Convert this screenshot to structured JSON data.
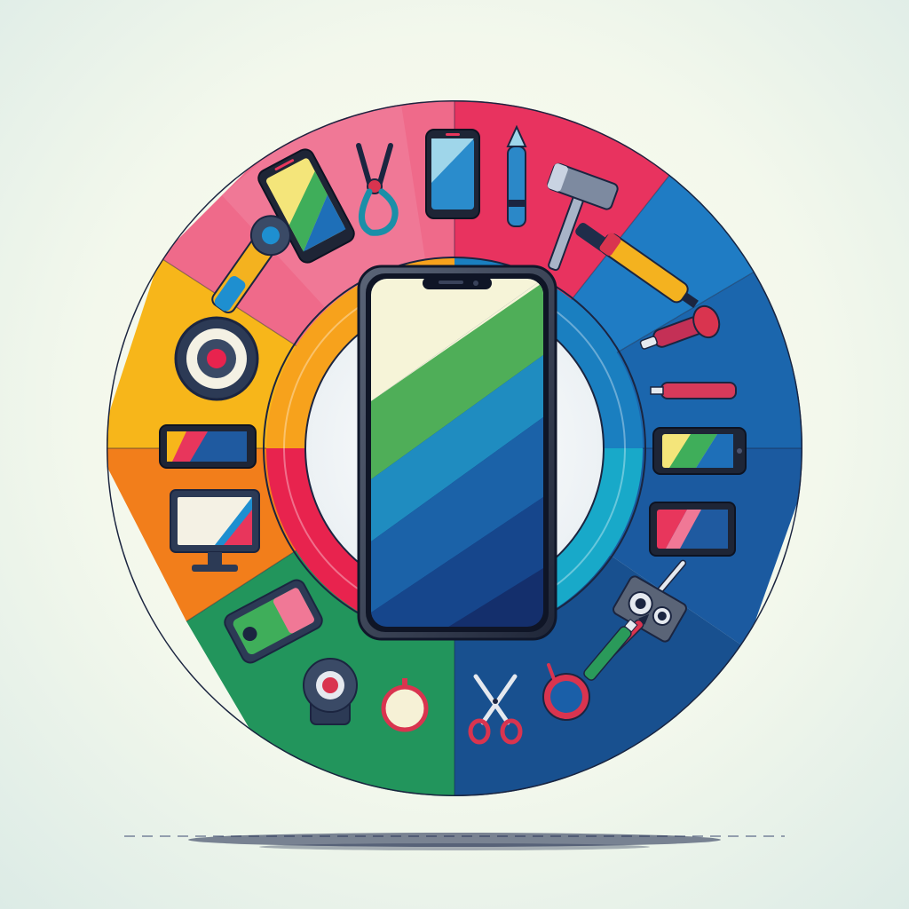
{
  "illustration": {
    "subject": "smartphone-repair-wheel",
    "palette": {
      "background": "#f4f8ec",
      "outline": "#1b2540",
      "segments": [
        "#e83a6a",
        "#f05a8a",
        "#e8365c",
        "#1f78c0",
        "#1a5fa8",
        "#1d4f8e",
        "#164a86",
        "#1e8f5c",
        "#2a9a5a",
        "#f07a1a",
        "#f5a21a",
        "#f8c21c"
      ],
      "screen_stripes": [
        "#f6f4d8",
        "#4fae58",
        "#1f8cc0",
        "#1b62a8",
        "#16468c",
        "#142f6c"
      ]
    },
    "tools": [
      {
        "icon": "smartphone-tilted-icon"
      },
      {
        "icon": "pliers-icon"
      },
      {
        "icon": "smartphone-small-icon"
      },
      {
        "icon": "spudger-icon"
      },
      {
        "icon": "hammer-icon"
      },
      {
        "icon": "screwdriver-icon"
      },
      {
        "icon": "glue-tube-icon"
      },
      {
        "icon": "suction-tool-icon"
      },
      {
        "icon": "pen-tool-icon"
      },
      {
        "icon": "phone-landscape-icon"
      },
      {
        "icon": "phone-landscape-red-icon"
      },
      {
        "icon": "probe-icon"
      },
      {
        "icon": "camera-module-icon"
      },
      {
        "icon": "marker-red-icon"
      },
      {
        "icon": "marker-green-icon"
      },
      {
        "icon": "magnifier-icon"
      },
      {
        "icon": "scissors-icon"
      },
      {
        "icon": "round-part-icon"
      },
      {
        "icon": "webcam-icon"
      },
      {
        "icon": "battery-icon"
      },
      {
        "icon": "monitor-icon"
      },
      {
        "icon": "phone-landscape-left-icon"
      },
      {
        "icon": "speaker-icon"
      },
      {
        "icon": "cutter-tool-icon"
      }
    ]
  }
}
